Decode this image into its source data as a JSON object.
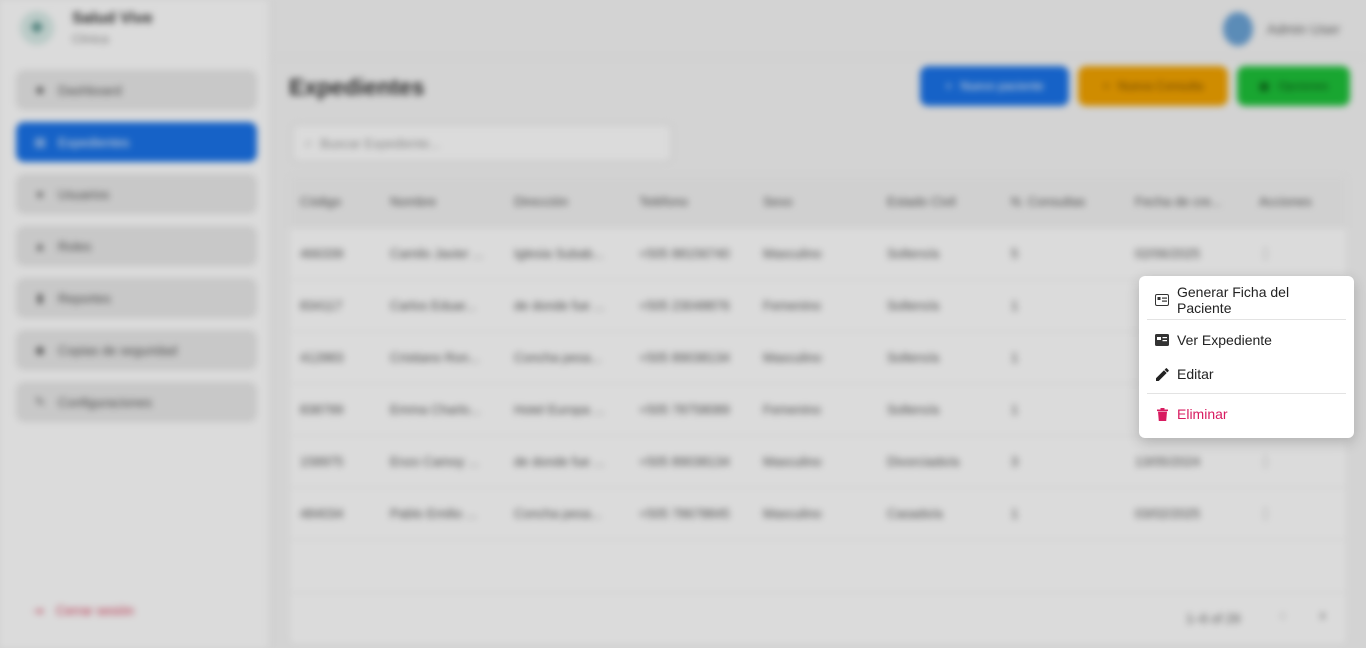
{
  "app": {
    "brand_title": "Salud Vive",
    "brand_sub": "Clínica",
    "user_name": "Admin User"
  },
  "sidebar": {
    "items": [
      {
        "label": "Dashboard"
      },
      {
        "label": "Expedientes"
      },
      {
        "label": "Usuarios"
      },
      {
        "label": "Roles"
      },
      {
        "label": "Reportes"
      },
      {
        "label": "Copias de seguridad"
      },
      {
        "label": "Configuraciones"
      }
    ],
    "logout": "Cerrar sesión"
  },
  "main": {
    "title": "Expedientes",
    "buttons": {
      "new_patient": "Nuevo paciente",
      "new_consult": "Nueva Consulta",
      "options": "Opciones"
    },
    "search_placeholder": "Buscar Expediente...",
    "columns": [
      "Código",
      "Nombre",
      "Dirección",
      "Teléfono",
      "Sexo",
      "Estado Civil",
      "N. Consultas",
      "Fecha de cre...",
      "Acciones"
    ],
    "rows": [
      [
        "466339",
        "Camilo Javier ...",
        "Iglesia Subab...",
        "+505 88156740",
        "Masculino",
        "Soltero/a",
        "5",
        "02/06/2025",
        "⋮"
      ],
      [
        "834117",
        "Carlos Eduar...",
        "de donde fue ...",
        "+505 23048876",
        "Femenino",
        "Soltero/a",
        "1",
        "",
        ""
      ],
      [
        "412883",
        "Cristiano Ron...",
        "Concha pesa...",
        "+505 89038134",
        "Masculino",
        "Soltero/a",
        "1",
        "",
        ""
      ],
      [
        "838799",
        "Emma Charlo...",
        "Hotel Europa ...",
        "+505 78758089",
        "Femenino",
        "Soltero/a",
        "1",
        "",
        ""
      ],
      [
        "158975",
        "Enzo Camoy ...",
        "de donde fue ...",
        "+505 89038134",
        "Masculino",
        "Divorciado/a",
        "3",
        "13/05/2024",
        "⋮"
      ],
      [
        "484034",
        "Pablo Emilio ...",
        "Concha pesa...",
        "+505 78678845",
        "Masculino",
        "Casado/a",
        "1",
        "03/02/2025",
        "⋮"
      ]
    ],
    "pagination": "1–6 of 29"
  },
  "context_menu": {
    "generate_sheet": "Generar Ficha del Paciente",
    "view_record": "Ver Expediente",
    "edit": "Editar",
    "delete": "Eliminar",
    "delete_color": "#d81b60"
  }
}
